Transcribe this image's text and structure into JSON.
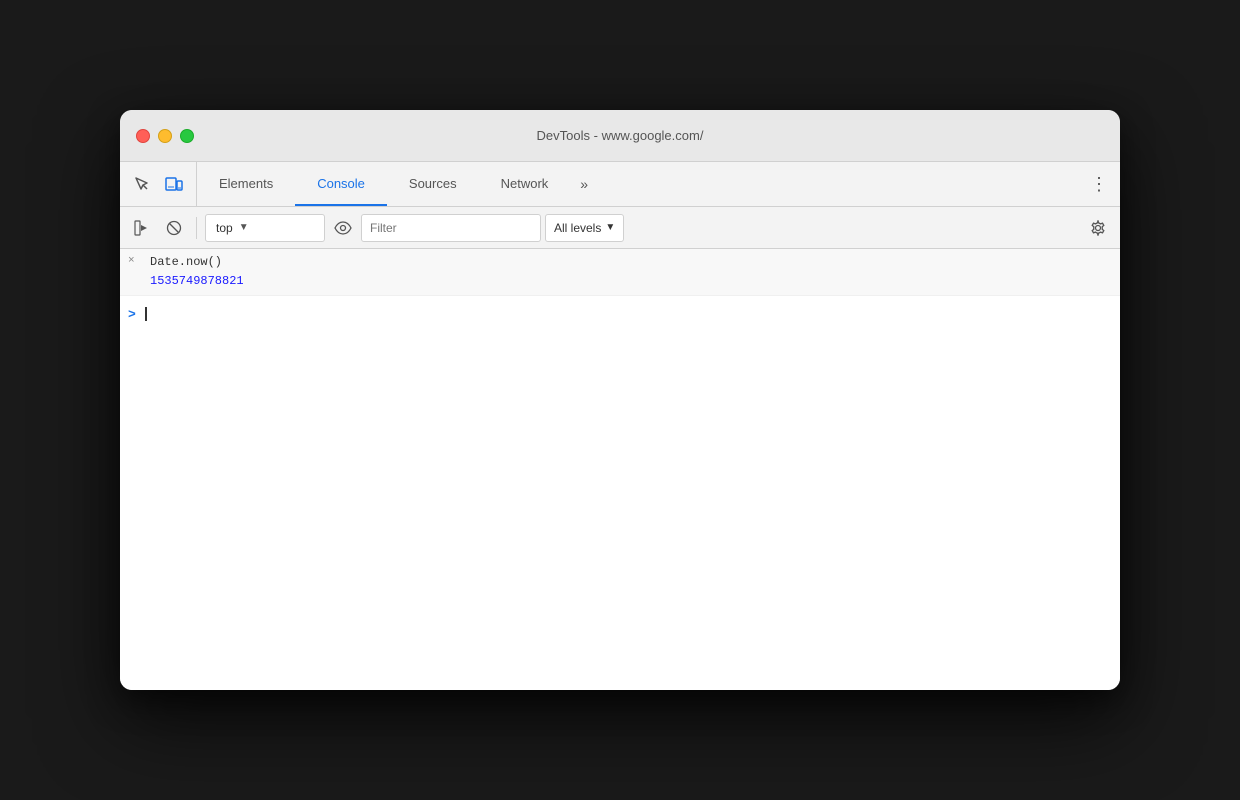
{
  "window": {
    "title": "DevTools - www.google.com/",
    "traffic_lights": {
      "close_label": "close",
      "minimize_label": "minimize",
      "maximize_label": "maximize"
    }
  },
  "tabs": {
    "items": [
      {
        "id": "elements",
        "label": "Elements",
        "active": false
      },
      {
        "id": "console",
        "label": "Console",
        "active": true
      },
      {
        "id": "sources",
        "label": "Sources",
        "active": false
      },
      {
        "id": "network",
        "label": "Network",
        "active": false
      }
    ],
    "more_label": "»",
    "menu_label": "⋮"
  },
  "toolbar": {
    "show_messages_label": "▶",
    "clear_label": "⊘",
    "context_value": "top",
    "context_arrow": "▼",
    "filter_placeholder": "Filter",
    "levels_label": "All levels",
    "levels_arrow": "▼",
    "settings_label": "⚙"
  },
  "console": {
    "entries": [
      {
        "type": "input",
        "icon": "×",
        "text": "Date.now()",
        "output": "1535749878821"
      }
    ],
    "prompt_label": ">"
  },
  "colors": {
    "accent_blue": "#1a73e8",
    "output_blue": "#1a1aff",
    "tab_active": "#1a73e8",
    "background": "#f3f3f3",
    "border": "#d0d0d0"
  }
}
